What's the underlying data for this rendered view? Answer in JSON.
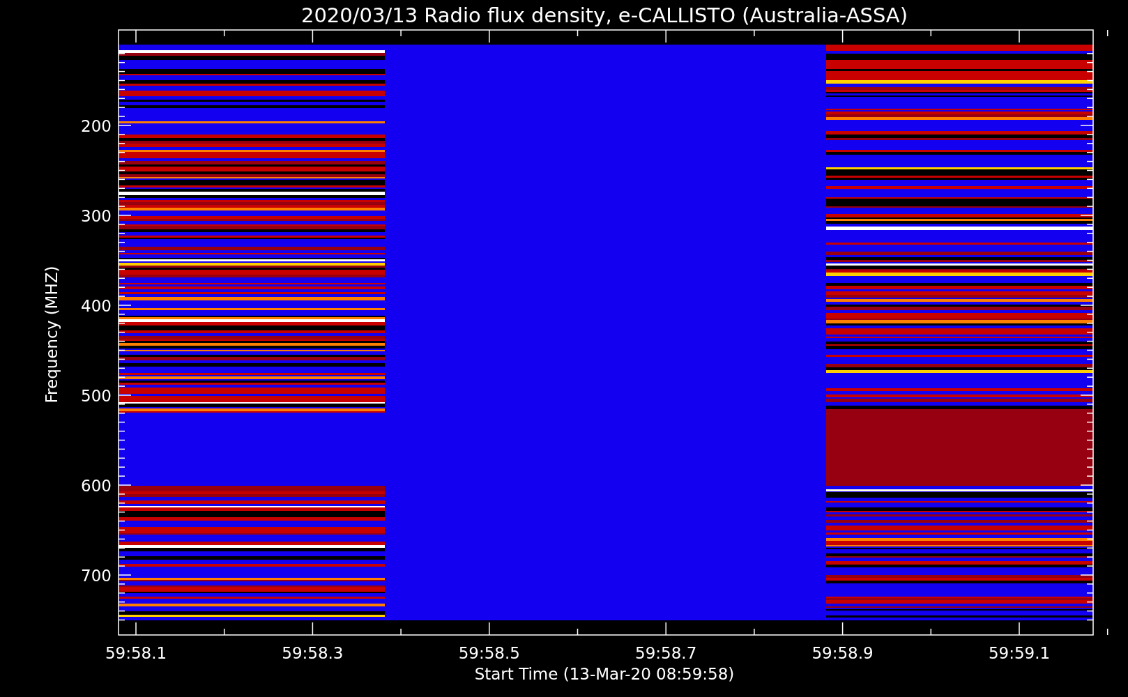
{
  "title": "2020/03/13  Radio flux density, e-CALLISTO (Australia-ASSA)",
  "y_axis": {
    "label": "Frequency (MHZ)",
    "ticks": [
      "200",
      "300",
      "400",
      "500",
      "600",
      "700"
    ]
  },
  "x_axis": {
    "label": "Start Time (13-Mar-20 08:59:58)",
    "ticks": [
      "59:58.1",
      "59:58.3",
      "59:58.5",
      "59:58.7",
      "59:58.9",
      "59:59.1"
    ]
  }
}
